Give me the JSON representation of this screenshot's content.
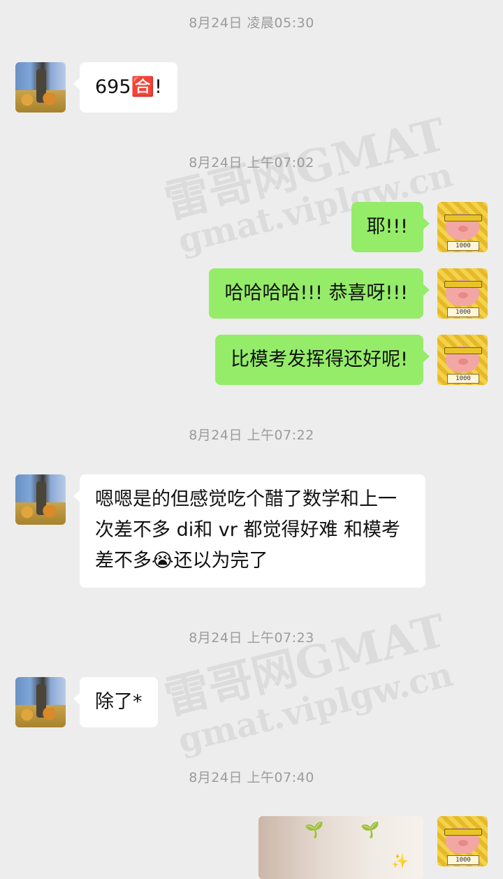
{
  "messages": [
    {
      "timestamp": "8月24日 凌晨05:30"
    },
    {
      "sender": "friend",
      "text": "695🈴!"
    },
    {
      "timestamp": "8月24日 上午07:02"
    },
    {
      "sender": "me",
      "text": "耶!!!"
    },
    {
      "sender": "me",
      "text": "哈哈哈哈!!! 恭喜呀!!!"
    },
    {
      "sender": "me",
      "text": "比模考发挥得还好呢!"
    },
    {
      "timestamp": "8月24日 上午07:22"
    },
    {
      "sender": "friend",
      "text": "嗯嗯是的但感觉吃个醋了数学和上一次差不多 di和 vr 都觉得好难 和模考差不多😭还以为完了"
    },
    {
      "timestamp": "8月24日 上午07:23"
    },
    {
      "sender": "friend",
      "text": "除了*"
    },
    {
      "timestamp": "8月24日 上午07:40"
    },
    {
      "sender": "me",
      "type": "image"
    }
  ],
  "avatar_sign_text": "1000",
  "watermark": {
    "brand": "雷哥网GMAT",
    "url": "gmat.viplgw.cn"
  },
  "colors": {
    "background": "#ededed",
    "incoming_bubble": "#ffffff",
    "outgoing_bubble": "#95ec69",
    "timestamp_text": "#9b9b9b"
  }
}
